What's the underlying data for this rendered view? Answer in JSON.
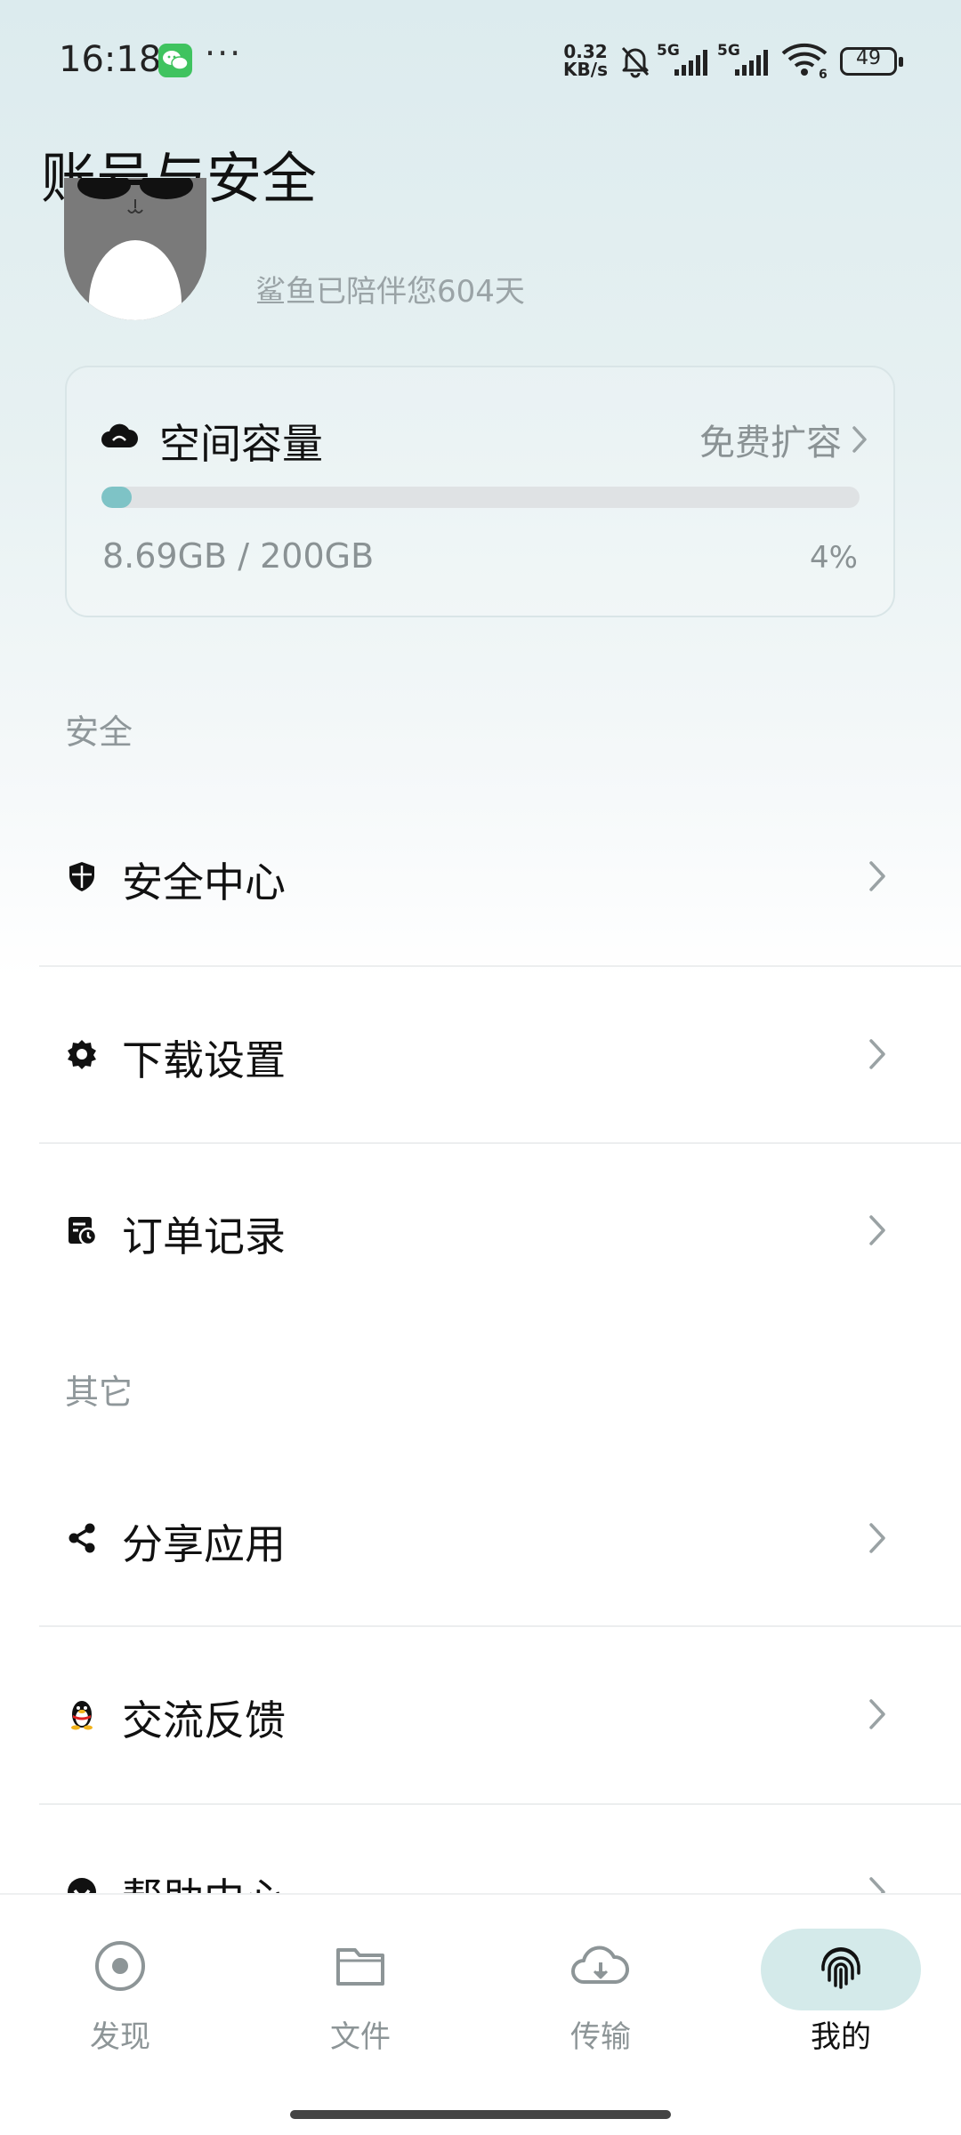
{
  "status_bar": {
    "time": "16:18",
    "more": "···",
    "net_speed_value": "0.32",
    "net_speed_unit": "KB/s",
    "signal_1": "5G",
    "signal_2": "5G",
    "wifi_badge": "6",
    "battery": "49"
  },
  "page": {
    "title": "账号与安全"
  },
  "profile": {
    "companion_text": "鲨鱼已陪伴您604天"
  },
  "storage": {
    "title": "空间容量",
    "expand_label": "免费扩容",
    "used": "8.69GB / 200GB",
    "percent_label": "4%",
    "progress_fraction": 0.04
  },
  "sections": [
    {
      "label": "安全",
      "items": [
        {
          "label": "安全中心",
          "icon": "shield-icon"
        },
        {
          "label": "下载设置",
          "icon": "gear-icon"
        },
        {
          "label": "订单记录",
          "icon": "order-history-icon"
        }
      ]
    },
    {
      "label": "其它",
      "items": [
        {
          "label": "分享应用",
          "icon": "share-icon"
        },
        {
          "label": "交流反馈",
          "icon": "qq-penguin-icon"
        },
        {
          "label": "帮助中心",
          "icon": "help-icon"
        }
      ]
    }
  ],
  "bottom_nav": [
    {
      "label": "发现",
      "icon": "discover-icon",
      "active": false
    },
    {
      "label": "文件",
      "icon": "folder-icon",
      "active": false
    },
    {
      "label": "传输",
      "icon": "cloud-download-icon",
      "active": false
    },
    {
      "label": "我的",
      "icon": "fingerprint-icon",
      "active": true
    }
  ],
  "colors": {
    "accent": "#7ec3c6",
    "active_pill": "#d4eaea",
    "muted_text": "#8a9294"
  }
}
